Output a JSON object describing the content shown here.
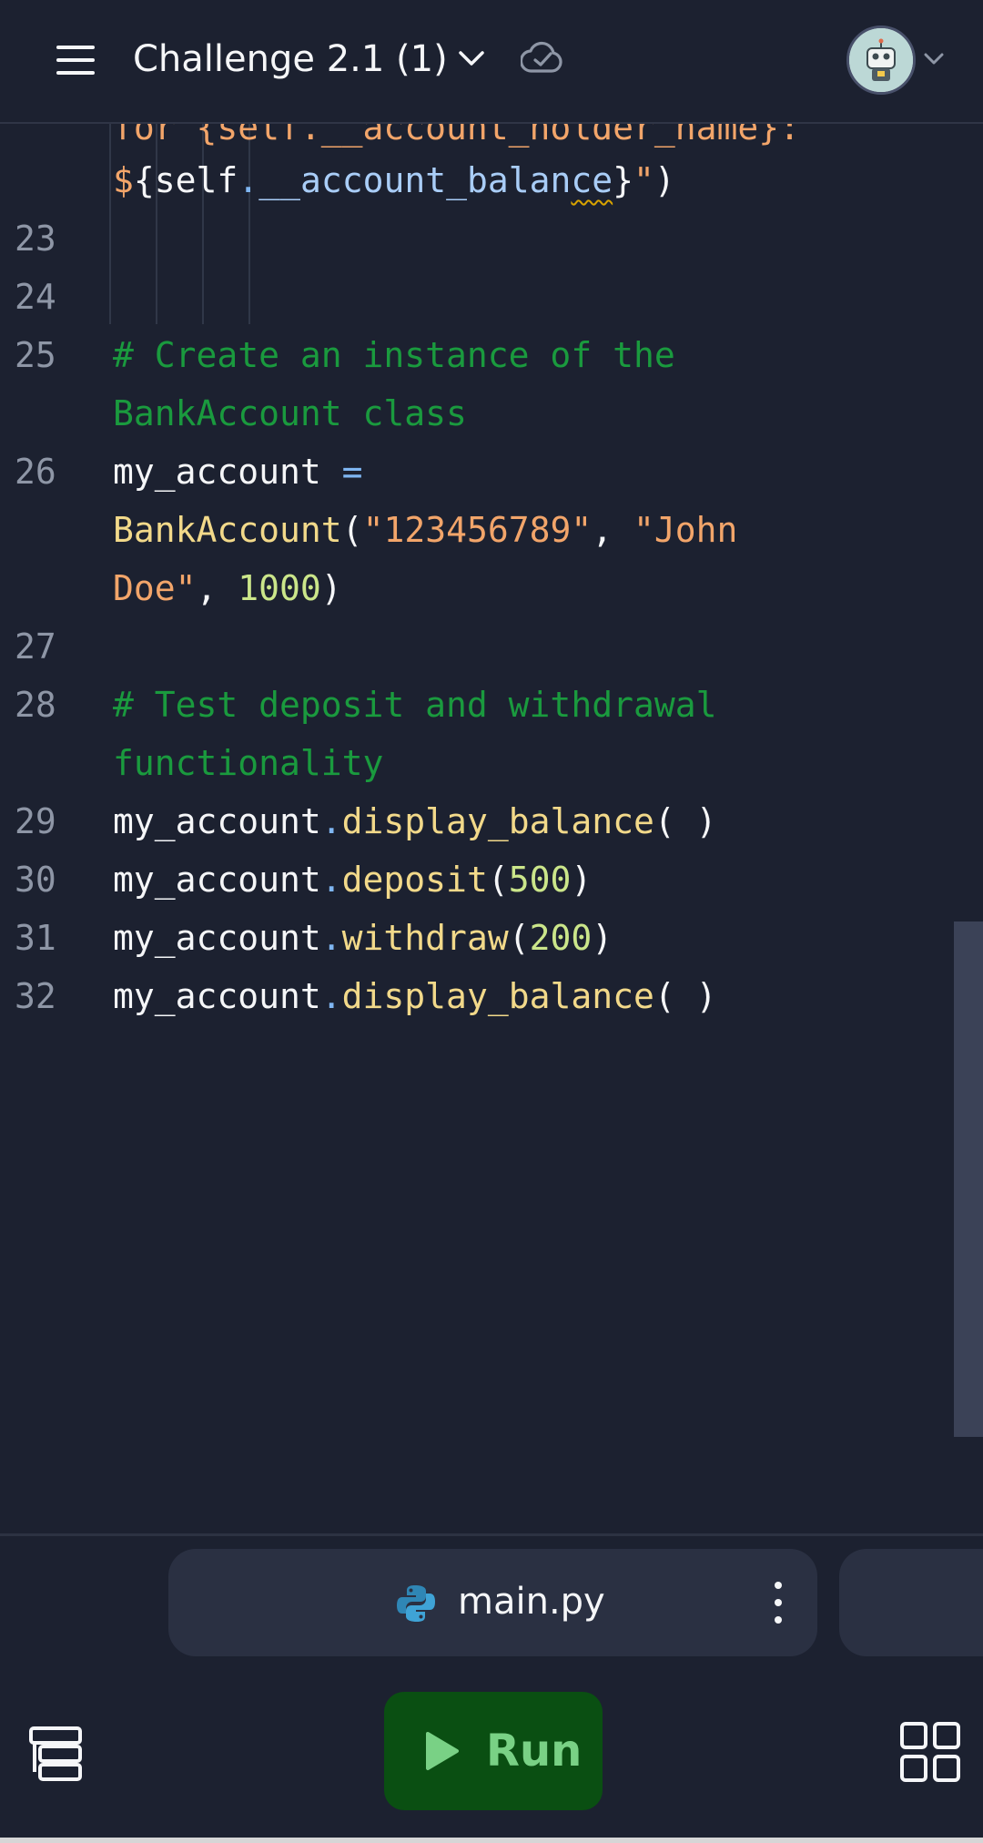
{
  "header": {
    "title": "Challenge 2.1 (1)",
    "menu_icon": "hamburger-menu-icon",
    "title_dropdown_icon": "chevron-down-icon",
    "status_icon": "cloud-check-icon",
    "avatar_icon": "robot-avatar-icon",
    "avatar_dropdown_icon": "chevron-down-icon"
  },
  "editor": {
    "partial_top_line": "for {self.__account_holder_name}:",
    "line_22_cont": {
      "dollar": "$",
      "open": "{",
      "self": "self",
      "dot": ".",
      "attr": "__account_balan",
      "attr_squiggle": "ce",
      "close": "}",
      "quote": "\"",
      "paren": ")"
    },
    "line_numbers": [
      "23",
      "24",
      "25",
      "26",
      "27",
      "28",
      "29",
      "30",
      "31",
      "32"
    ],
    "line_25": {
      "comment_1": "# Create an instance of the",
      "comment_2": "BankAccount class"
    },
    "line_26": {
      "var": "my_account",
      "eq": " =",
      "cls": "BankAccount",
      "open": "(",
      "arg1": "\"123456789\"",
      "comma1": ", ",
      "arg2a": "\"John",
      "arg2b": "Doe\"",
      "comma2": ", ",
      "arg3": "1000",
      "close": ")"
    },
    "line_28": {
      "comment_1": "# Test deposit and withdrawal",
      "comment_2": "functionality"
    },
    "line_29": {
      "var": "my_account",
      "dot": ".",
      "method": "display_balance",
      "args": "( )"
    },
    "line_30": {
      "var": "my_account",
      "dot": ".",
      "method": "deposit",
      "open": "(",
      "arg": "500",
      "close": ")"
    },
    "line_31": {
      "var": "my_account",
      "dot": ".",
      "method": "withdraw",
      "open": "(",
      "arg": "200",
      "close": ")"
    },
    "line_32": {
      "var": "my_account",
      "dot": ".",
      "method": "display_balance",
      "args": "( )"
    }
  },
  "tabs": {
    "active_file": "main.py",
    "file_icon": "python-icon",
    "more_icon": "kebab-menu-icon"
  },
  "bottom_bar": {
    "run_label": "Run",
    "run_icon": "play-icon",
    "files_icon": "file-tree-icon",
    "layout_icon": "grid-icon"
  },
  "colors": {
    "background": "#1c2130",
    "comment": "#1a9a3e",
    "string": "#f2a56a",
    "number": "#cbe68a",
    "function": "#f2d98a",
    "run_button": "#0a4f12",
    "run_text": "#79d185"
  }
}
